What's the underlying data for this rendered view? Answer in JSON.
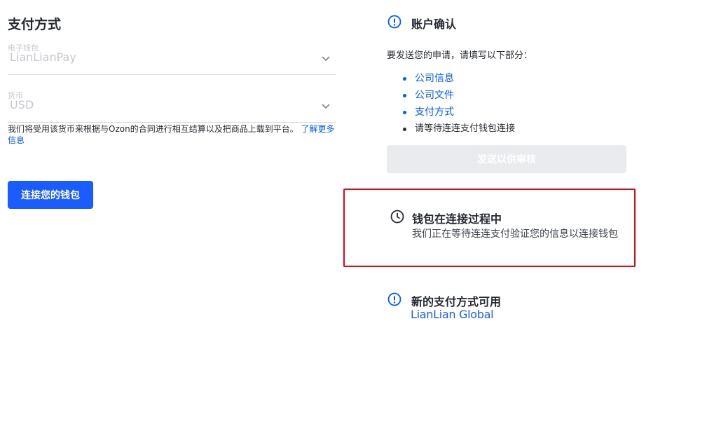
{
  "payment": {
    "title": "支付方式",
    "wallet_label": "电子钱包",
    "wallet_value": "LianLianPay",
    "currency_label": "货币",
    "currency_value": "USD",
    "helper_text": "我们将受用该货币来根据与Ozon的合同进行相互结算以及把商品上载到平台。",
    "helper_link": "了解更多信息",
    "connect_button": "连接您的钱包"
  },
  "account": {
    "title": "账户确认",
    "description": "要发送您的申请，请填写以下部分：",
    "items": [
      {
        "label": "公司信息"
      },
      {
        "label": "公司文件"
      },
      {
        "label": "支付方式"
      },
      {
        "label": "请等待连连支付钱包连接"
      }
    ],
    "submit_button": "发送以供审核"
  },
  "pending": {
    "title": "钱包在连接过程中",
    "text": "我们正在等待连连支付验证您的信息以连接钱包"
  },
  "new_method": {
    "title": "新的支付方式可用",
    "logo_text": "LianLian Global"
  },
  "colors": {
    "accent": "#005bff",
    "button_primary": "#1a5cff",
    "highlight_border": "#e30613",
    "disabled_button": "#e9ebef"
  },
  "icons": [
    "chevron-down-icon",
    "info-icon",
    "clock-icon"
  ]
}
